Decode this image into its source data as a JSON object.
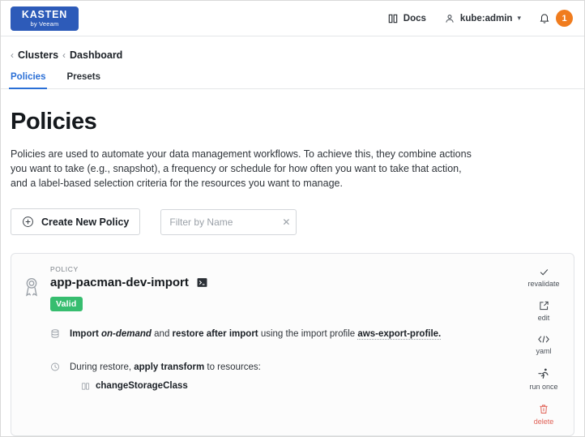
{
  "topbar": {
    "logo": {
      "main": "KASTEN",
      "sub": "by Veeam",
      "color": "#2d5bb9"
    },
    "docs_label": "Docs",
    "docs_icon": "book-icon",
    "user_label": "kube:admin",
    "user_icon": "user-icon",
    "user_chevron": "chevron-down-icon",
    "bell_icon": "bell-icon",
    "notification_count": "1",
    "notification_color": "#f07c1e"
  },
  "breadcrumb": {
    "separator": "‹",
    "items": [
      {
        "label": "Clusters"
      },
      {
        "label": "Dashboard"
      }
    ]
  },
  "tabs": [
    {
      "label": "Policies",
      "active": true
    },
    {
      "label": "Presets",
      "active": false
    }
  ],
  "page": {
    "title": "Policies",
    "description": "Policies are used to automate your data management workflows. To achieve this, they combine actions you want to take (e.g., snapshot), a frequency or schedule for how often you want to take that action, and a label-based selection criteria for the resources you want to manage."
  },
  "toolbar": {
    "create_label": "Create New Policy",
    "create_icon": "plus-circle-icon",
    "filter_placeholder": "Filter by Name",
    "filter_value": "",
    "filter_clear_icon": "close-icon"
  },
  "policy": {
    "kicker": "POLICY",
    "name": "app-pacman-dev-import",
    "ribbon_icon": "award-ribbon-icon",
    "terminal_icon": "terminal-icon",
    "status": {
      "label": "Valid",
      "color": "#37bd6f"
    },
    "details": [
      {
        "icon": "database-icon",
        "segments": [
          {
            "text": "Import ",
            "style": "bold"
          },
          {
            "text": "on-demand",
            "style": "bold-italic"
          },
          {
            "text": " and ",
            "style": "normal"
          },
          {
            "text": "restore after import",
            "style": "bold"
          },
          {
            "text": " using the import profile ",
            "style": "normal"
          },
          {
            "text": "aws-export-profile.",
            "style": "dotted"
          }
        ]
      },
      {
        "icon": "clock-icon",
        "segments": [
          {
            "text": "During restore, ",
            "style": "normal"
          },
          {
            "text": "apply transform",
            "style": "bold"
          },
          {
            "text": " to resources:",
            "style": "normal"
          }
        ],
        "subitems": [
          {
            "icon": "transform-icon",
            "label": "changeStorageClass"
          }
        ]
      }
    ],
    "actions": [
      {
        "label": "revalidate",
        "icon": "check-icon",
        "danger": false
      },
      {
        "label": "edit",
        "icon": "edit-square-icon",
        "danger": false
      },
      {
        "label": "yaml",
        "icon": "code-brackets-icon",
        "danger": false
      },
      {
        "label": "run once",
        "icon": "runner-icon",
        "danger": false
      },
      {
        "label": "delete",
        "icon": "trash-icon",
        "danger": true
      }
    ]
  }
}
